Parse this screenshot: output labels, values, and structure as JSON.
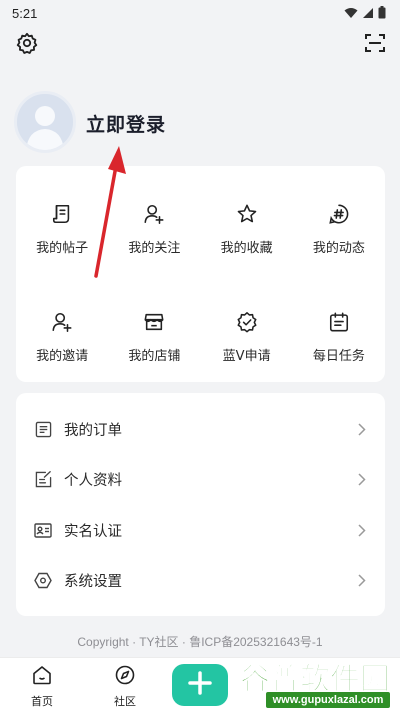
{
  "status_bar": {
    "time": "5:21",
    "icons": [
      "wifi-icon",
      "signal-icon",
      "battery-icon"
    ]
  },
  "header": {
    "icons": [
      "settings-icon",
      "scan-icon"
    ]
  },
  "profile": {
    "login_label": "立即登录"
  },
  "grid": {
    "items": [
      {
        "label": "我的帖子",
        "icon": "post-icon"
      },
      {
        "label": "我的关注",
        "icon": "follow-icon"
      },
      {
        "label": "我的收藏",
        "icon": "star-icon"
      },
      {
        "label": "我的动态",
        "icon": "hashtag-icon"
      },
      {
        "label": "我的邀请",
        "icon": "invite-icon"
      },
      {
        "label": "我的店铺",
        "icon": "store-icon"
      },
      {
        "label": "蓝V申请",
        "icon": "verified-badge-icon"
      },
      {
        "label": "每日任务",
        "icon": "calendar-icon"
      }
    ]
  },
  "list": {
    "items": [
      {
        "label": "我的订单",
        "icon": "order-icon"
      },
      {
        "label": "个人资料",
        "icon": "profile-edit-icon"
      },
      {
        "label": "实名认证",
        "icon": "id-card-icon"
      },
      {
        "label": "系统设置",
        "icon": "system-settings-icon"
      }
    ]
  },
  "footer": {
    "copyright": "Copyright · TY社区 · 鲁ICP备2025321643号-1"
  },
  "bottom_nav": {
    "items": [
      {
        "label": "首页",
        "icon": "home-icon"
      },
      {
        "label": "社区",
        "icon": "compass-icon"
      }
    ],
    "fab_icon": "plus-icon"
  },
  "watermark": {
    "brand": "谷普软件园",
    "url": "www.gupuxlazal.com"
  },
  "colors": {
    "accent": "#23c5a3",
    "arrow": "#d9262c",
    "background": "#f2f3f5"
  }
}
